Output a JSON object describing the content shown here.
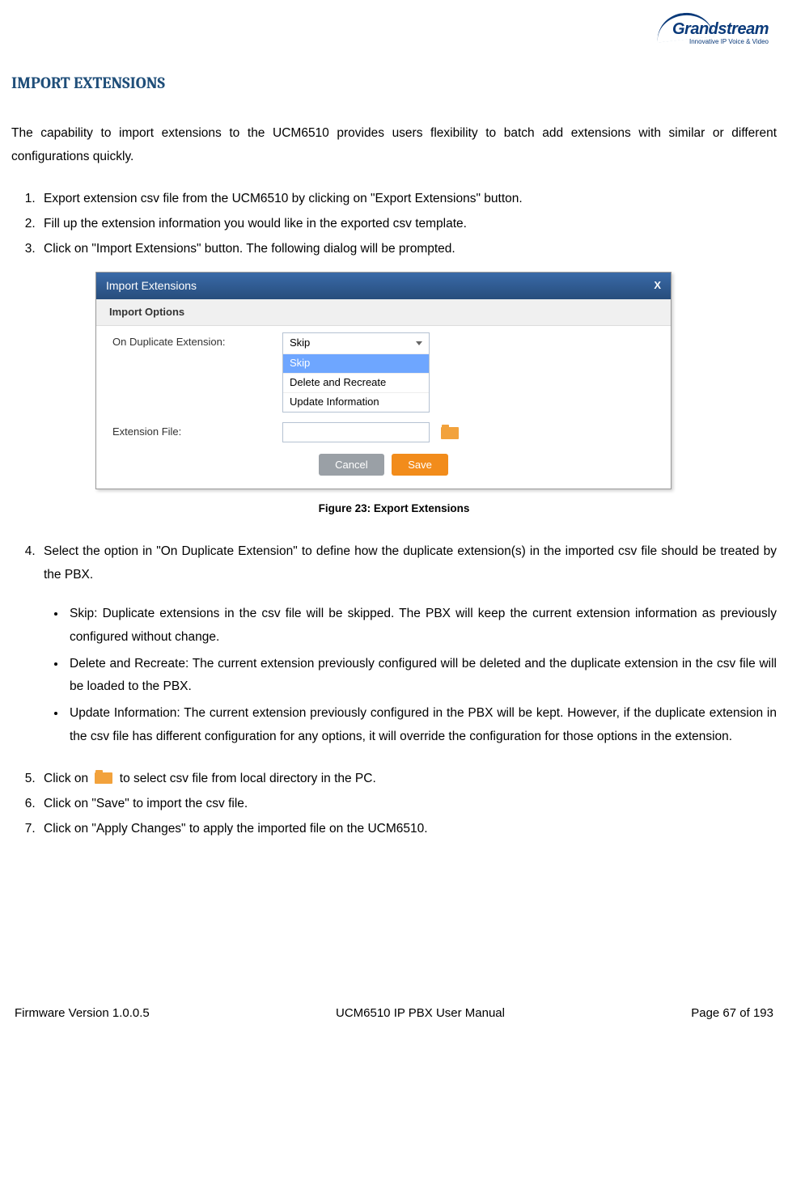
{
  "logo": {
    "brand": "Grandstream",
    "tagline": "Innovative IP Voice & Video"
  },
  "heading": "IMPORT EXTENSIONS",
  "intro": "The capability to import extensions to the UCM6510 provides users flexibility to batch add extensions with similar or different configurations quickly.",
  "steps": {
    "s1": "Export extension csv file from the UCM6510 by clicking on \"Export Extensions\" button.",
    "s2": "Fill up the extension information you would like in the exported csv template.",
    "s3": "Click on \"Import Extensions\" button. The following dialog will be prompted.",
    "s4": "Select the option in \"On Duplicate Extension\" to define how the duplicate extension(s) in the imported csv file should be treated by the PBX.",
    "s5_pre": "Click on",
    "s5_post": "to select csv file from local directory in the PC.",
    "s6": "Click on \"Save\" to import the csv file.",
    "s7": "Click on \"Apply Changes\" to apply the imported file on the UCM6510."
  },
  "bullets": {
    "b1": "Skip: Duplicate extensions in the csv file will be skipped. The PBX will keep the current extension information as previously configured without change.",
    "b2": "Delete and Recreate: The current extension previously configured will be deleted and the duplicate extension in the csv file will be loaded to the PBX.",
    "b3": "Update Information: The current extension previously configured in the PBX will be kept. However, if the duplicate extension in the csv file has different configuration for any options, it will override the configuration for those options in the extension."
  },
  "dialog": {
    "title": "Import Extensions",
    "close": "X",
    "section": "Import Options",
    "label_duplicate": "On Duplicate Extension:",
    "label_file": "Extension File:",
    "select_value": "Skip",
    "options": {
      "o1": "Skip",
      "o2": "Delete and Recreate",
      "o3": "Update Information"
    },
    "cancel": "Cancel",
    "save": "Save"
  },
  "figure_caption": "Figure 23: Export Extensions",
  "footer": {
    "left": "Firmware Version 1.0.0.5",
    "center": "UCM6510 IP PBX User Manual",
    "right": "Page 67 of 193"
  }
}
